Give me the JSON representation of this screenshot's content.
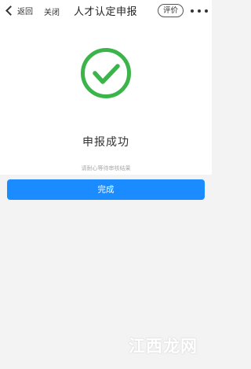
{
  "nav": {
    "back_label": "返回",
    "close_label": "关闭",
    "title": "人才认定申报",
    "rate_label": "评价"
  },
  "result": {
    "icon": "check-circle-icon",
    "status_title": "申报成功",
    "status_hint": "请耐心等待审核结果",
    "success_color": "#3bb54a"
  },
  "actions": {
    "done_label": "完成",
    "accent_color": "#1a8cff"
  },
  "watermark": {
    "text": "江西龙网"
  }
}
